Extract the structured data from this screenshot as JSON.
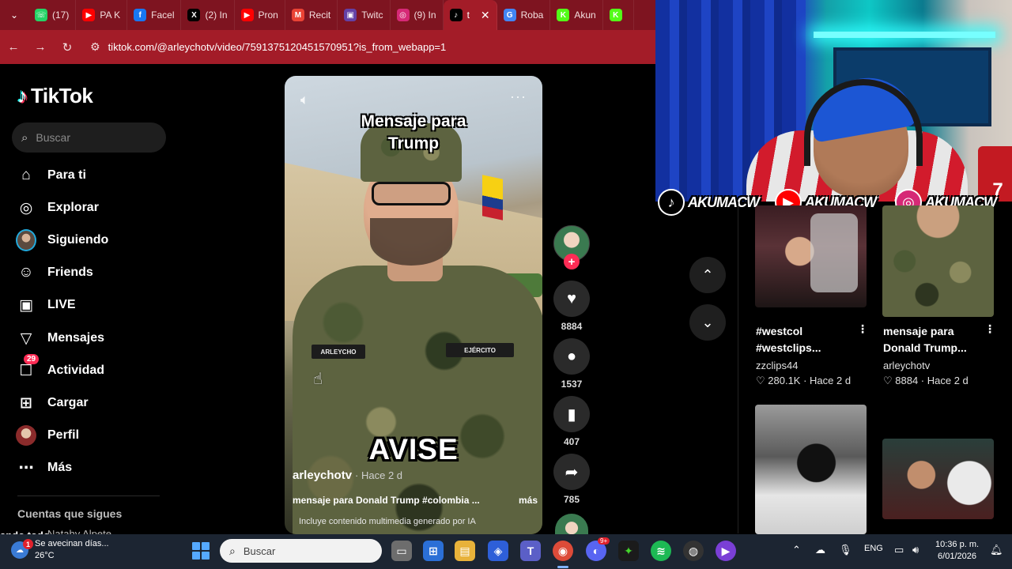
{
  "browser": {
    "tabs": [
      {
        "label": "(17)",
        "icon": "whatsapp-icon",
        "color": "#25d366",
        "glyph": "☏"
      },
      {
        "label": "PA K",
        "icon": "youtube-icon",
        "color": "#ff0000",
        "glyph": "▶"
      },
      {
        "label": "Facel",
        "icon": "facebook-icon",
        "color": "#1877f2",
        "glyph": "f"
      },
      {
        "label": "(2) In",
        "icon": "x-icon",
        "color": "#000000",
        "glyph": "X"
      },
      {
        "label": "Pron",
        "icon": "youtube-icon",
        "color": "#ff0000",
        "glyph": "▶"
      },
      {
        "label": "Recit",
        "icon": "gmail-icon",
        "color": "#ea4335",
        "glyph": "M"
      },
      {
        "label": "Twitc",
        "icon": "twitch-icon",
        "color": "#6441a5",
        "glyph": "▣"
      },
      {
        "label": "(9) In",
        "icon": "instagram-icon",
        "color": "#d62976",
        "glyph": "◎"
      },
      {
        "label": "t",
        "icon": "tiktok-icon",
        "color": "#000000",
        "glyph": "♪",
        "active": true
      },
      {
        "label": "Roba",
        "icon": "google-icon",
        "color": "#4285f4",
        "glyph": "G"
      },
      {
        "label": "Akun",
        "icon": "kick-icon",
        "color": "#53fc18",
        "glyph": "K"
      },
      {
        "label": "",
        "icon": "kick-icon",
        "color": "#53fc18",
        "glyph": "K"
      }
    ],
    "url": "tiktok.com/@arleychotv/video/7591375120451570951?is_from_webapp=1"
  },
  "tiktok": {
    "logo": "TikTok",
    "search_placeholder": "Buscar",
    "nav": [
      {
        "label": "Para ti",
        "icon": "home-icon",
        "glyph": "⌂"
      },
      {
        "label": "Explorar",
        "icon": "compass-icon",
        "glyph": "◎"
      },
      {
        "label": "Siguiendo",
        "icon": "following-avatar-icon",
        "glyph": ""
      },
      {
        "label": "Friends",
        "icon": "friends-icon",
        "glyph": "☺"
      },
      {
        "label": "LIVE",
        "icon": "live-icon",
        "glyph": "▣"
      },
      {
        "label": "Mensajes",
        "icon": "messages-icon",
        "glyph": "▽"
      },
      {
        "label": "Actividad",
        "icon": "activity-icon",
        "glyph": "☐",
        "badge": "29"
      },
      {
        "label": "Cargar",
        "icon": "upload-icon",
        "glyph": "⊞"
      },
      {
        "label": "Perfil",
        "icon": "profile-avatar-icon",
        "glyph": ""
      },
      {
        "label": "Más",
        "icon": "more-dots-icon",
        "glyph": "⋯"
      }
    ],
    "following_title": "Cuentas que sigues",
    "cut_text": "ando todo",
    "cut_text2": "Natahy Alpete"
  },
  "video": {
    "overlay_title": "Mensaje para\nTrump",
    "overlay_big": "AVISE",
    "tag_left": "ARLEYCHO",
    "tag_right": "EJÉRCITO",
    "author": "arleychotv",
    "time": "· Hace 2 d",
    "caption": "mensaje para Donald Trump #colombia ...",
    "more": "más",
    "ai_label": "Incluye contenido multimedia generado por IA",
    "likes": "8884",
    "comments": "1537",
    "saves": "407",
    "shares": "785"
  },
  "overlay": {
    "socials": [
      {
        "name": "AKUMACW",
        "icon": "tiktok-icon",
        "color": "#000000",
        "glyph": "♪"
      },
      {
        "name": "AKUMACW",
        "icon": "youtube-icon",
        "color": "#ff0000",
        "glyph": "▶"
      },
      {
        "name": "AKUMACW",
        "icon": "instagram-icon",
        "color": "#d62976",
        "glyph": "◎"
      }
    ],
    "jersey_number": "7"
  },
  "related": [
    {
      "title1": "#westcol",
      "title2": "#westclips...",
      "user": "zzclips44",
      "stats": "♡ 280.1K · Hace 2 d"
    },
    {
      "title1": "mensaje para",
      "title2": "Donald Trump...",
      "user": "arleychotv",
      "stats": "♡ 8884 · Hace 2 d"
    }
  ],
  "taskbar": {
    "weather_line1": "Se avecinan días...",
    "weather_line2": "26°C",
    "weather_badge": "1",
    "search_placeholder": "Buscar",
    "language": "ENG",
    "time": "10:36 p. m.",
    "date": "6/01/2026",
    "discord_badge": "9+"
  }
}
